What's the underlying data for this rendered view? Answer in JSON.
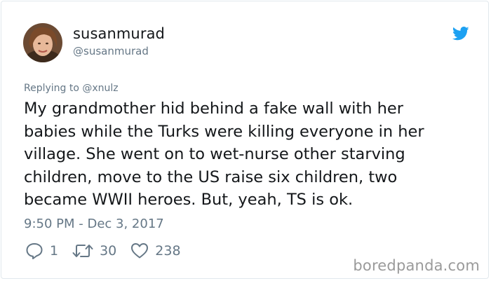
{
  "author": {
    "display_name": "susanmurad",
    "handle": "@susanmurad"
  },
  "tweet": {
    "replying_to": "Replying to @xnulz",
    "lines": [
      "My grandmother hid behind a fake wall with her",
      "babies while the Turks were killing everyone in her",
      "village. She went on to wet-nurse other starving",
      "children, move to the US raise six children, two",
      "became WWII heroes. But, yeah, TS is ok."
    ],
    "timestamp": "9:50 PM - Dec 3, 2017"
  },
  "actions": {
    "replies": "1",
    "retweets": "30",
    "likes": "238"
  },
  "watermark": "boredpanda.com",
  "colors": {
    "twitter_blue": "#1da1f2",
    "text_primary": "#14171a",
    "text_secondary": "#657786",
    "watermark": "#9a9a9a"
  },
  "icons": {
    "brand": "twitter-bird-icon",
    "reply": "reply-bubble-icon",
    "retweet": "retweet-icon",
    "like": "heart-icon"
  }
}
